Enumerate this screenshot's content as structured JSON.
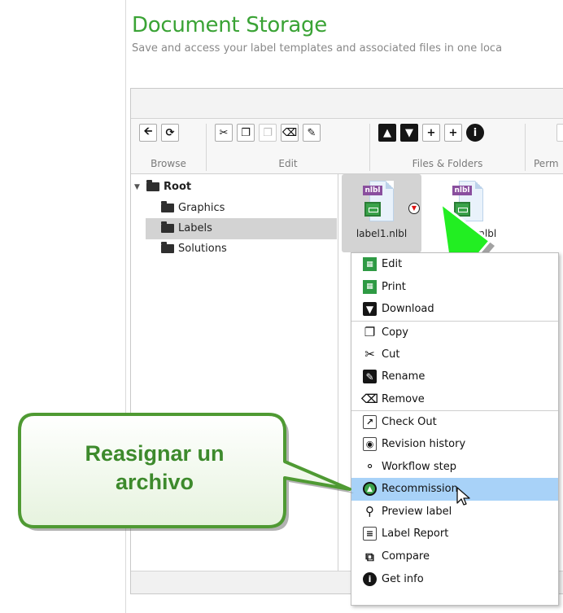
{
  "header": {
    "title": "Document Storage",
    "subtitle": "Save and access your label templates and associated files in one loca"
  },
  "ribbon": {
    "groups": [
      {
        "label": "Browse",
        "icons": [
          "back-arrow-icon",
          "refresh-icon"
        ]
      },
      {
        "label": "Edit",
        "icons": [
          "cut-icon",
          "copy-icon",
          "paste-icon",
          "delete-icon",
          "rename-icon"
        ]
      },
      {
        "label": "Files & Folders",
        "icons": [
          "upload-icon",
          "download-icon",
          "new-folder-icon",
          "new-file-icon",
          "info-icon"
        ]
      },
      {
        "label": "Perm",
        "icons": [
          "permissions-icon"
        ]
      }
    ]
  },
  "tree": {
    "root": "Root",
    "children": [
      "Graphics",
      "Labels",
      "Solutions"
    ],
    "selected": "Labels"
  },
  "files": [
    {
      "badge": "nlbl",
      "name": "label1.nlbl",
      "selected": true
    },
    {
      "badge": "nlbl",
      "name": "label2.nlbl",
      "selected": false
    }
  ],
  "context_menu": {
    "items": [
      {
        "label": "Edit",
        "icon": "edit-label-icon"
      },
      {
        "label": "Print",
        "icon": "print-label-icon"
      },
      {
        "label": "Download",
        "icon": "download-icon"
      },
      {
        "label": "Copy",
        "icon": "copy-icon"
      },
      {
        "label": "Cut",
        "icon": "scissors-icon"
      },
      {
        "label": "Rename",
        "icon": "rename-icon"
      },
      {
        "label": "Remove",
        "icon": "trash-icon"
      },
      {
        "label": "Check Out",
        "icon": "check-out-icon"
      },
      {
        "label": "Revision history",
        "icon": "revision-history-icon"
      },
      {
        "label": "Workflow step",
        "icon": "workflow-icon"
      },
      {
        "label": "Recommission",
        "icon": "recommission-icon"
      },
      {
        "label": "Preview label",
        "icon": "magnifier-icon"
      },
      {
        "label": "Label Report",
        "icon": "report-icon"
      },
      {
        "label": "Compare",
        "icon": "compare-icon"
      },
      {
        "label": "Get info",
        "icon": "info-icon"
      }
    ],
    "highlighted": "Recommission"
  },
  "callout": {
    "line1": "Reasignar un",
    "line2": "archivo",
    "color": "#3d8a2c"
  },
  "colors": {
    "title_green": "#3aa335",
    "highlight_blue": "#a8d2f8",
    "arrow_green": "#22ee22"
  }
}
